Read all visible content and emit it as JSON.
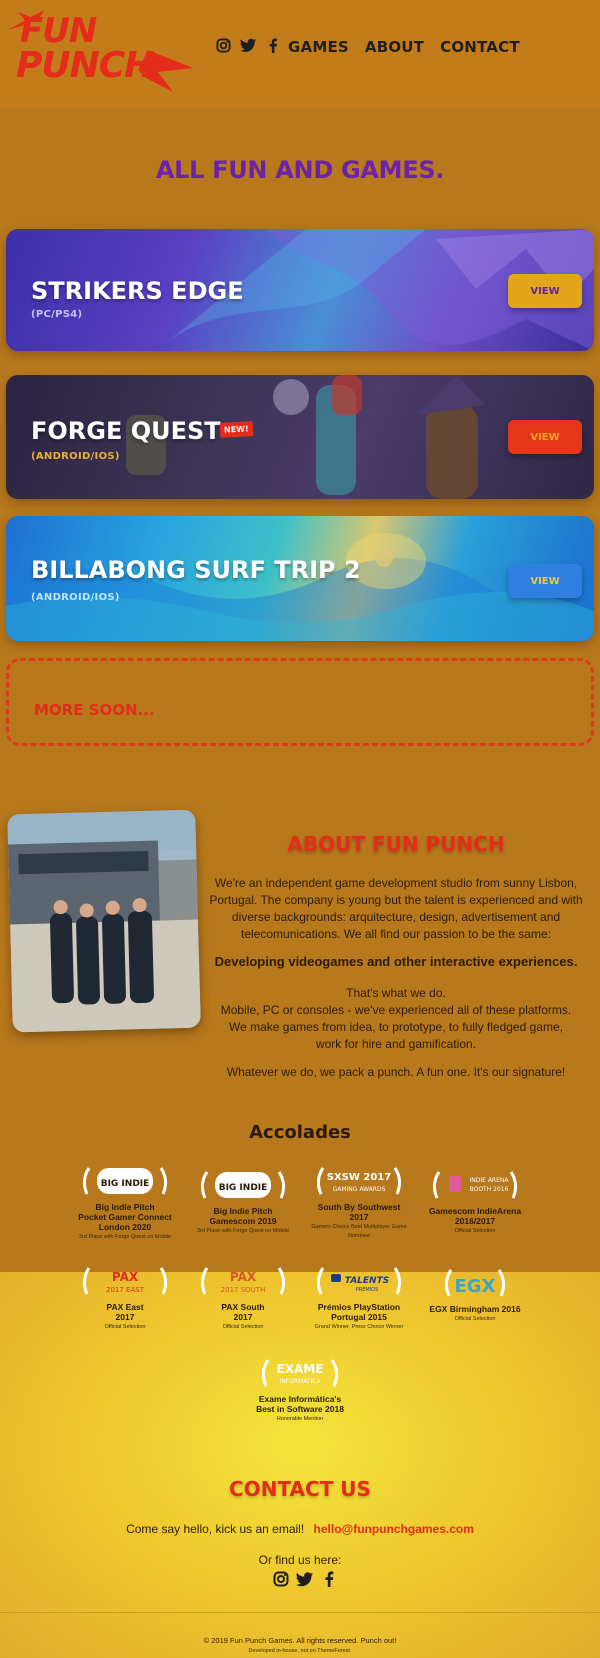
{
  "brand": {
    "logo_line1": "FUN",
    "logo_line2": "PUNCH",
    "red": "#e32c1a",
    "purple": "#6a22a8"
  },
  "nav": {
    "games": "GAMES",
    "about": "ABOUT",
    "contact": "CONTACT"
  },
  "social": [
    "instagram-icon",
    "twitter-icon",
    "facebook-icon"
  ],
  "games_section": {
    "title": "ALL FUN AND GAMES.",
    "cards": [
      {
        "title": "STRIKERS EDGE",
        "platform": "(PC/PS4)",
        "button": "VIEW"
      },
      {
        "title": "FORGE QUEST",
        "platform": "(ANDROID/IOS)",
        "badge": "NEW!",
        "button": "VIEW"
      },
      {
        "title": "BILLABONG SURF TRIP 2",
        "platform": "(ANDROID/IOS)",
        "button": "VIEW"
      }
    ],
    "more_soon": "MORE SOON..."
  },
  "about": {
    "title": "ABOUT FUN PUNCH",
    "p1": "We're an independent game development studio from sunny Lisbon, Portugal. The company is young but the talent is experienced and with diverse backgrounds: arquitecture, design, advertisement and telecomunications. We all find our passion to be the same:",
    "strong": "Developing videogames and other interactive experiences.",
    "p2_line1": "That's what we do.",
    "p2_line2": "Mobile, PC or consoles - we've experienced all of these platforms.",
    "p2_line3": "We make games from idea, to prototype, to fully fledged game,",
    "p2_line4": "work for hire and gamification.",
    "p3": "Whatever we do, we pack a punch. A fun one. It's our signature!"
  },
  "accolades": {
    "title": "Accolades",
    "items": [
      {
        "logo": "BIG INDIE PITCH",
        "name_l1": "Big Indie Pitch",
        "name_l2": "Pocket Gamer Connect",
        "name_l3": "London 2020",
        "desc_l1": "3rd Place with Forge Quest on Mobile",
        "desc_l2": ""
      },
      {
        "logo": "BIG INDIE PITCH",
        "name_l1": "Big Indie Pitch",
        "name_l2": "Gamescom 2019",
        "name_l3": "",
        "desc_l1": "3rd Place with Forge Quest on Mobile",
        "desc_l2": ""
      },
      {
        "logo": "SXSW 2017 GAMING AWARDS",
        "name_l1": "South By Southwest",
        "name_l2": "2017",
        "name_l3": "",
        "desc_l1": "Gamers Choice Best Multiplayer Game",
        "desc_l2": "Nominee"
      },
      {
        "logo": "INDIE ARENA BOOTH 2016",
        "name_l1": "Gamescom IndieArena",
        "name_l2": "2016/2017",
        "name_l3": "",
        "desc_l1": "Official Selection",
        "desc_l2": ""
      },
      {
        "logo": "PAX 2017 EAST",
        "name_l1": "PAX East",
        "name_l2": "2017",
        "name_l3": "",
        "desc_l1": "Official Selection",
        "desc_l2": ""
      },
      {
        "logo": "PAX 2017 SOUTH",
        "name_l1": "PAX South",
        "name_l2": "2017",
        "name_l3": "",
        "desc_l1": "Official Selection",
        "desc_l2": ""
      },
      {
        "logo": "TALENTS PRÉMIOS",
        "name_l1": "Prémios PlayStation",
        "name_l2": "Portugal 2015",
        "name_l3": "",
        "desc_l1": "Grand Winner, Press Choice Winner",
        "desc_l2": ""
      },
      {
        "logo": "EGX",
        "name_l1": "EGX Birmingham 2016",
        "name_l2": "",
        "name_l3": "",
        "desc_l1": "Official Selection",
        "desc_l2": ""
      },
      {
        "logo": "EXAME INFORMÁTICA",
        "name_l1": "Exame Informática's",
        "name_l2": "Best in Software 2018",
        "name_l3": "",
        "desc_l1": "Honorable Mention",
        "desc_l2": ""
      }
    ]
  },
  "contact": {
    "title": "CONTACT US",
    "line": "Come say hello, kick us an email!",
    "email": "hello@funpunchgames.com",
    "find_us": "Or find us here:"
  },
  "footer": {
    "copyright": "© 2019 Fun Punch Games. All rights reserved. Punch out!",
    "sub": "Developed in-house, not on ThemeForest."
  }
}
